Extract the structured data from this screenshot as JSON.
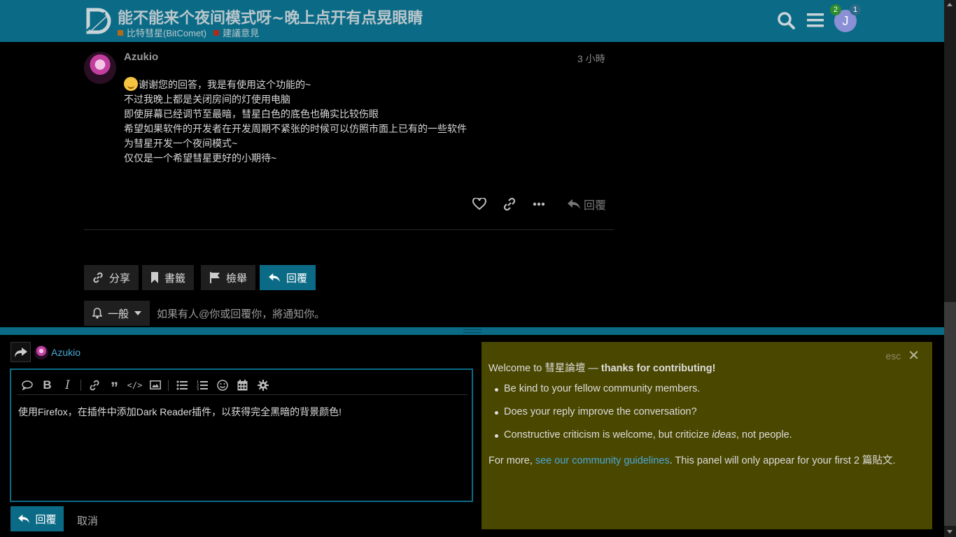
{
  "header": {
    "topic_title": "能不能来个夜间模式呀~晚上点开有点晃眼睛",
    "crumbs": [
      {
        "label": "比特彗星(BitComet)",
        "color": "#b06a1c"
      },
      {
        "label": "建議意見",
        "color": "#b02a1c"
      }
    ],
    "avatar_letter": "J",
    "notif_badge_green": "2",
    "notif_badge_blue": "1"
  },
  "post": {
    "username": "Azukio",
    "time": "3 小時",
    "lines": [
      "谢谢您的回答，我是有使用这个功能的~",
      "不过我晚上都是关闭房间的灯使用电脑",
      "即使屏幕已经调节至最暗，彗星白色的底色也确实比较伤眼",
      "希望如果软件的开发者在开发周期不紧张的时候可以仿照市面上已有的一些软件",
      "为彗星开发一个夜间模式~",
      "仅仅是一个希望彗星更好的小期待~"
    ],
    "reply_label": "回覆"
  },
  "footer_buttons": {
    "share": "分享",
    "bookmark": "書籤",
    "flag": "檢舉",
    "reply": "回覆"
  },
  "notification": {
    "level": "一般",
    "description": "如果有人@你或回覆你，將通知你。"
  },
  "composer": {
    "reply_to_user": "Azukio",
    "editor_text": "使用Firefox，在插件中添加Dark Reader插件，以获得完全黑暗的背景颜色!",
    "submit_label": "回覆",
    "cancel_label": "取消"
  },
  "welcome_panel": {
    "esc_label": "esc",
    "intro_prefix": "Welcome to ",
    "site_name": "彗星論壇",
    "intro_dash": " — ",
    "intro_bold": "thanks for contributing!",
    "bullet1": "Be kind to your fellow community members.",
    "bullet2": "Does your reply improve the conversation?",
    "bullet3_prefix": "Constructive criticism is welcome, but criticize ",
    "bullet3_italic": "ideas",
    "bullet3_suffix": ", not people.",
    "more_prefix": "For more, ",
    "more_link": "see our community guidelines",
    "more_suffix": ". This panel will only appear for your first 2 篇貼文."
  },
  "colors": {
    "header_bg": "#0b6b86",
    "panel_bg": "#4a4700",
    "link": "#4aa8d8"
  }
}
